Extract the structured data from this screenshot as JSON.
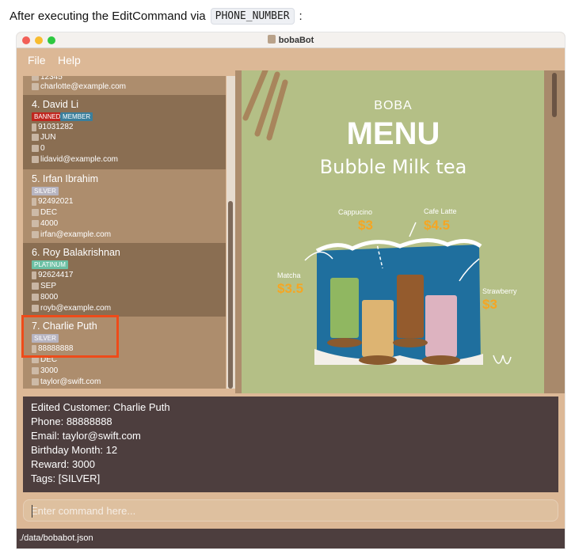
{
  "caption": {
    "prefix": "After executing the EditCommand via",
    "code": "PHONE_NUMBER",
    "suffix": ":"
  },
  "window": {
    "title": "bobaBot"
  },
  "menu": {
    "file": "File",
    "help": "Help"
  },
  "customers": {
    "partial": {
      "phone": "12345",
      "email": "charlotte@example.com"
    },
    "c4": {
      "name": "4.  David Li",
      "tags": [
        "BANNED",
        "MEMBER"
      ],
      "phone": "91031282",
      "month": "JUN",
      "reward": "0",
      "email": "lidavid@example.com"
    },
    "c5": {
      "name": "5.  Irfan Ibrahim",
      "tags": [
        "SILVER"
      ],
      "phone": "92492021",
      "month": "DEC",
      "reward": "4000",
      "email": "irfan@example.com"
    },
    "c6": {
      "name": "6.  Roy Balakrishnan",
      "tags": [
        "PLATINUM"
      ],
      "phone": "92624417",
      "month": "SEP",
      "reward": "8000",
      "email": "royb@example.com"
    },
    "c7": {
      "name": "7.  Charlie Puth",
      "tags": [
        "SILVER"
      ],
      "phone": "88888888",
      "month": "DEC",
      "reward": "3000",
      "email": "taylor@swift.com"
    }
  },
  "poster": {
    "boba": "BOBA",
    "title": "MENU",
    "subtitle": "Bubble Milk tea",
    "drinks": [
      {
        "name": "Cappucino",
        "price": "$3"
      },
      {
        "name": "Cafe Latte",
        "price": "$4.5"
      },
      {
        "name": "Matcha",
        "price": "$3.5"
      },
      {
        "name": "Strawberry",
        "price": "$3"
      }
    ]
  },
  "result": {
    "lines": [
      "Edited Customer: Charlie Puth",
      "Phone: 88888888",
      "Email: taylor@swift.com",
      "Birthday Month: 12",
      "Reward: 3000",
      "Tags: [SILVER]"
    ]
  },
  "command": {
    "placeholder": "Enter command here..."
  },
  "status": {
    "path": "./data/bobabot.json"
  },
  "colors": {
    "accent": "#ee4b1a",
    "window_bg": "#dcb896",
    "result_bg": "#4d3e3e",
    "poster_bg": "#b4bf86"
  }
}
